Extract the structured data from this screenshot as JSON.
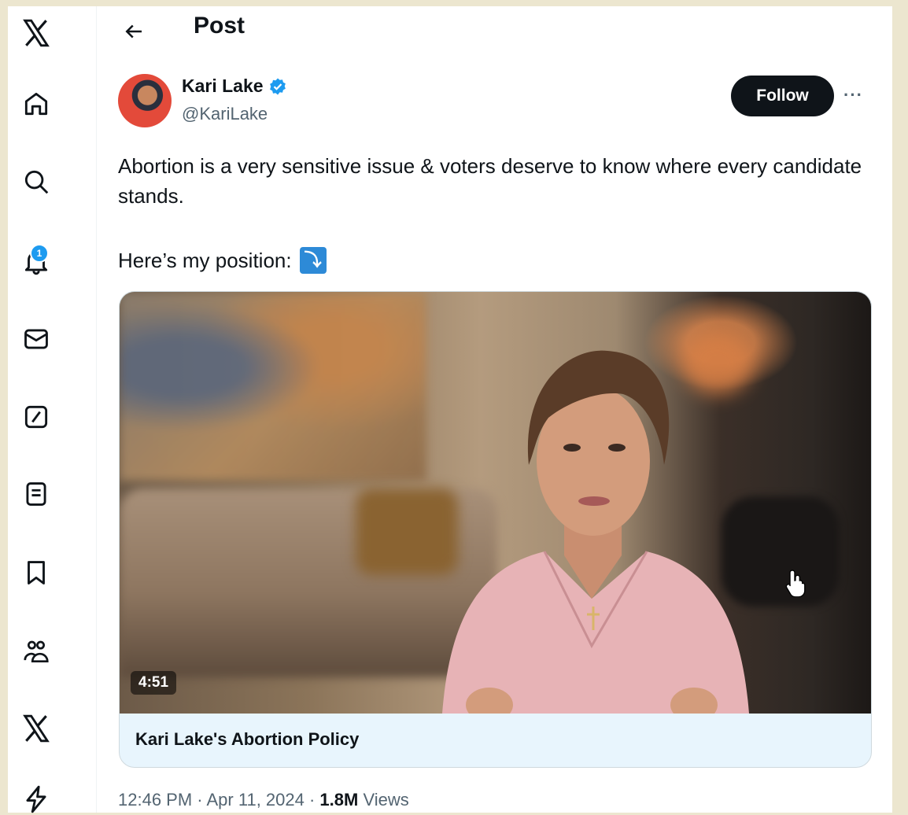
{
  "header": {
    "title": "Post"
  },
  "sidebar": {
    "items": [
      {
        "name": "x-logo-icon"
      },
      {
        "name": "home-icon"
      },
      {
        "name": "search-icon"
      },
      {
        "name": "notifications-icon",
        "badge": "1"
      },
      {
        "name": "messages-icon"
      },
      {
        "name": "grok-icon"
      },
      {
        "name": "lists-icon"
      },
      {
        "name": "bookmarks-icon"
      },
      {
        "name": "communities-icon"
      },
      {
        "name": "premium-icon"
      },
      {
        "name": "verified-orgs-icon"
      }
    ]
  },
  "author": {
    "name": "Kari Lake",
    "handle": "@KariLake",
    "verified": true,
    "follow_label": "Follow",
    "more_label": "···"
  },
  "post": {
    "text": "Abortion is a very sensitive issue & voters deserve to know where every candidate stands.",
    "text2": "Here’s my position:",
    "emoji": "⤵",
    "video_duration": "4:51",
    "media_title": "Kari Lake's Abortion Policy",
    "time": "12:46 PM · Apr 11, 2024 · ",
    "views_count": "1.8M",
    "views_label": " Views"
  },
  "colors": {
    "accent": "#1d9bf0",
    "text": "#0f1419",
    "muted": "#536471",
    "card_bg": "#e8f5fd"
  }
}
